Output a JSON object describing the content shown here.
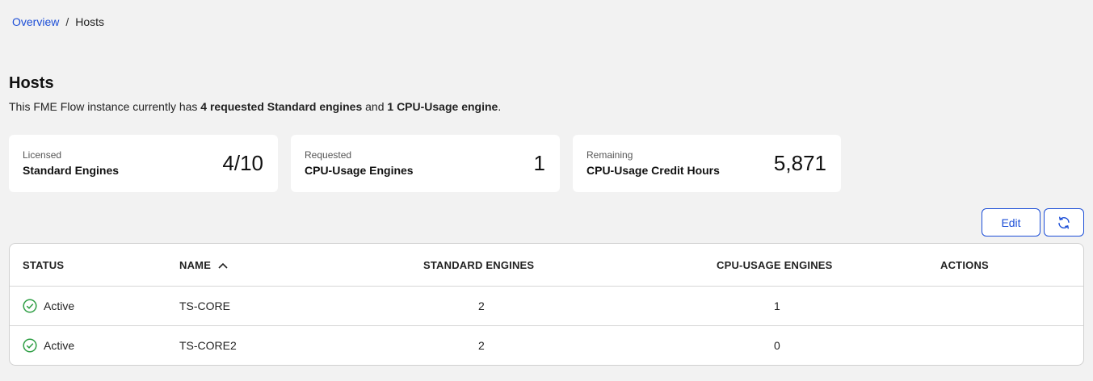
{
  "breadcrumb": {
    "parent": "Overview",
    "separator": "/",
    "current": "Hosts"
  },
  "page": {
    "title": "Hosts",
    "summary_prefix": "This FME Flow instance currently has ",
    "summary_bold1": "4 requested Standard engines",
    "summary_mid": " and ",
    "summary_bold2": "1 CPU-Usage engine",
    "summary_suffix": "."
  },
  "cards": [
    {
      "small": "Licensed",
      "label": "Standard Engines",
      "value": "4/10"
    },
    {
      "small": "Requested",
      "label": "CPU-Usage Engines",
      "value": "1"
    },
    {
      "small": "Remaining",
      "label": "CPU-Usage Credit Hours",
      "value": "5,871"
    }
  ],
  "toolbar": {
    "edit_label": "Edit",
    "refresh_icon": "refresh-icon"
  },
  "table": {
    "headers": {
      "status": "STATUS",
      "name": "NAME",
      "standard": "STANDARD ENGINES",
      "cpu": "CPU-USAGE ENGINES",
      "actions": "ACTIONS"
    },
    "sort": {
      "column": "name",
      "direction": "ascending",
      "icon": "chevron-up-icon"
    },
    "rows": [
      {
        "status": "Active",
        "name": "TS-CORE",
        "standard": "2",
        "cpu": "1"
      },
      {
        "status": "Active",
        "name": "TS-CORE2",
        "standard": "2",
        "cpu": "0"
      }
    ]
  },
  "colors": {
    "link": "#1d4fd7",
    "active": "#2e9e44",
    "background": "#f2f2f2"
  }
}
